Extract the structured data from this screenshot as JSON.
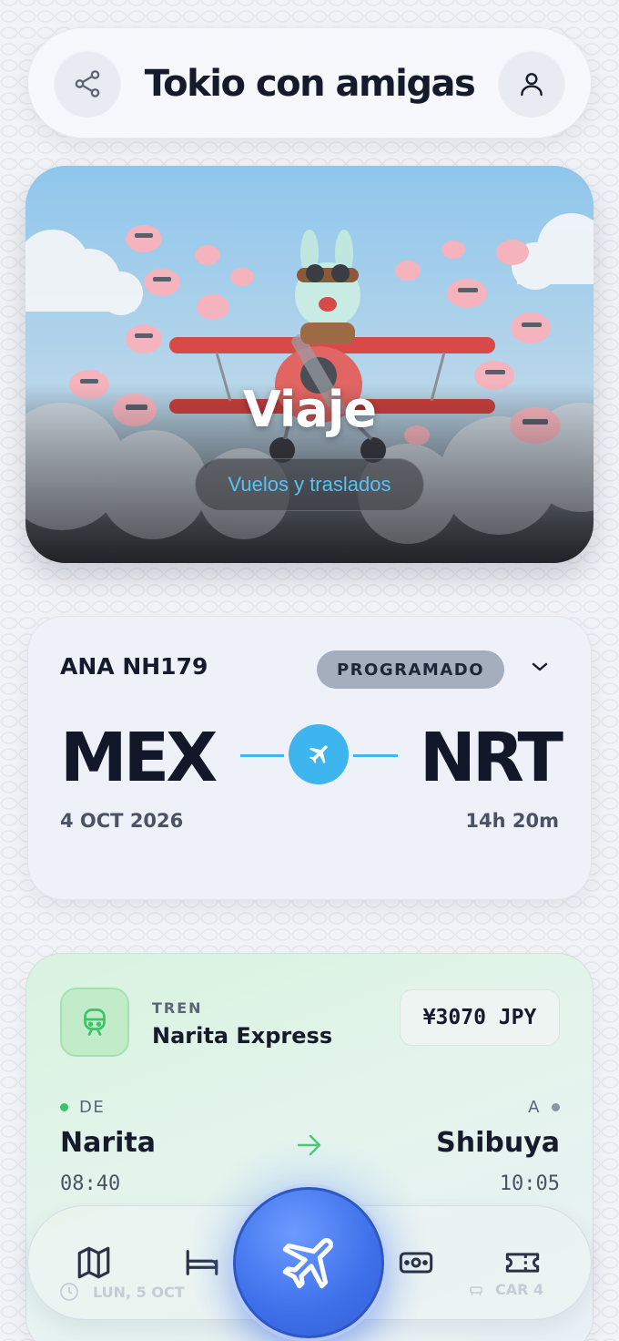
{
  "header": {
    "title": "Tokio con amigas",
    "share_icon": "share-icon",
    "profile_icon": "user-icon"
  },
  "hero": {
    "title": "Viaje",
    "subtitle": "Vuelos y traslados"
  },
  "flight": {
    "airline": "ANA NH179",
    "status": "PROGRAMADO",
    "origin": "MEX",
    "destination": "NRT",
    "date": "4 OCT 2026",
    "duration": "14h 20m",
    "accent": "#3db5ef"
  },
  "train": {
    "type": "TREN",
    "name": "Narita Express",
    "price": "¥3070 JPY",
    "from_label": "DE",
    "to_label": "A",
    "from_city": "Narita",
    "to_city": "Shibuya",
    "depart_time": "08:40",
    "arrive_time": "10:05",
    "date": "LUN, 5 OCT",
    "car": "CAR 4",
    "accent": "#3cc36a"
  },
  "nav": {
    "items": [
      "map-icon",
      "bed-icon",
      "plane-icon",
      "money-icon",
      "ticket-icon"
    ],
    "active": "plane-icon",
    "active_color": "#3d6fea"
  }
}
